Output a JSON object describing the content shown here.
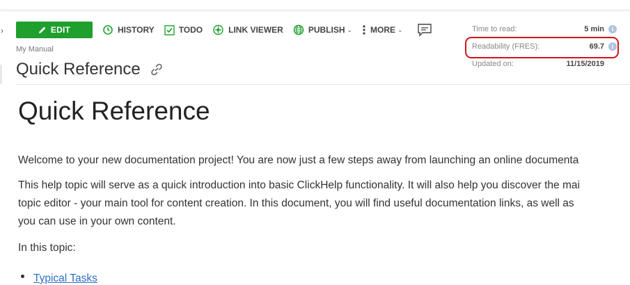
{
  "toolbar": {
    "edit": "EDIT",
    "history": "HISTORY",
    "todo": "TODO",
    "link_viewer": "LINK VIEWER",
    "publish": "PUBLISH",
    "more": "MORE"
  },
  "breadcrumb": "My Manual",
  "page_title": "Quick Reference",
  "meta": {
    "time_to_read_label": "Time to read:",
    "time_to_read_value": "5 min",
    "readability_label": "Readability (FRES):",
    "readability_value": "69.7",
    "updated_label": "Updated on:",
    "updated_value": "11/15/2019"
  },
  "content": {
    "heading": "Quick Reference",
    "paragraph1": "Welcome to your new documentation project! You are now just a few steps away from launching an online documenta",
    "paragraph2_lines": [
      "This help topic will serve as a quick introduction into basic ClickHelp functionality. It will also help you discover the mai",
      "topic editor - your main tool for content creation. In this document, you will find useful documentation links, as well as",
      "you can use in your own content."
    ],
    "in_this_topic": "In this topic:",
    "list_items": [
      "Typical Tasks"
    ]
  },
  "colors": {
    "edit_button": "#1e9f2e",
    "highlight_border": "#d1141c",
    "link": "#2a6fc4",
    "info_icon": "#aec3df"
  }
}
